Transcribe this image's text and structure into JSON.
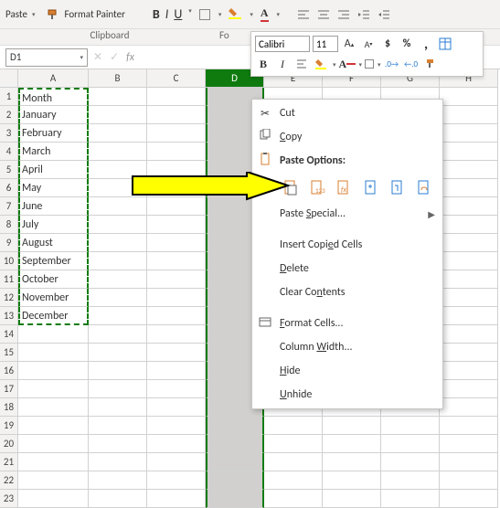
{
  "ribbon": {
    "paste_label": "Paste",
    "format_painter": "Format Painter",
    "clipboard_section": "Clipboard",
    "font_section_partial": "Fo"
  },
  "mini_toolbar": {
    "font": "Calibri",
    "size": "11"
  },
  "namebox": {
    "value": "D1",
    "fx": "fx"
  },
  "columns": [
    "A",
    "B",
    "C",
    "D",
    "E",
    "F",
    "G",
    "H"
  ],
  "rows_count": 23,
  "selected_column_index": 3,
  "data_col_a": [
    "Month",
    "January",
    "February",
    "March",
    "April",
    "May",
    "June",
    "July",
    "August",
    "September",
    "October",
    "November",
    "December"
  ],
  "context_menu": {
    "cut": "Cut",
    "copy": "Copy",
    "paste_options": "Paste Options:",
    "paste_special": "Paste Special...",
    "insert_copied": "Insert Copied Cells",
    "delete": "Delete",
    "clear_contents": "Clear Contents",
    "format_cells": "Format Cells...",
    "column_width": "Column Width...",
    "hide": "Hide",
    "unhide": "Unhide"
  }
}
